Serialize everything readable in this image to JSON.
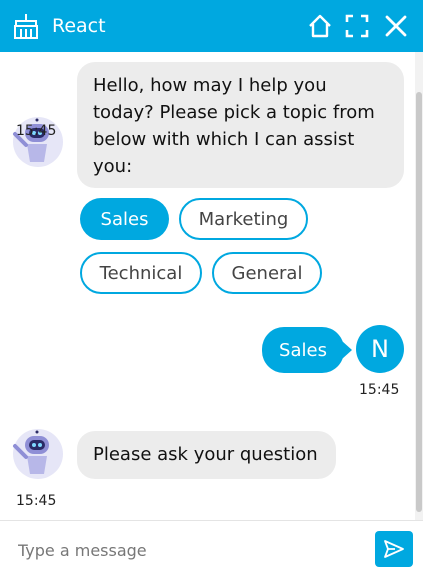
{
  "header": {
    "title": "React",
    "bg_color": "#00a8e0",
    "icons": [
      "broom-icon",
      "home-icon",
      "expand-icon",
      "close-icon"
    ]
  },
  "conversation": {
    "msg1": {
      "sender": "bot",
      "text": "Hello, how may I help you today? Please pick a topic from below with which I can assist you:",
      "time": "15:45",
      "options": [
        {
          "label": "Sales",
          "selected": true
        },
        {
          "label": "Marketing",
          "selected": false
        },
        {
          "label": "Technical",
          "selected": false
        },
        {
          "label": "General",
          "selected": false
        }
      ]
    },
    "msg2": {
      "sender": "user",
      "text": "Sales",
      "avatar_initial": "N",
      "time": "15:45"
    },
    "msg3": {
      "sender": "bot",
      "text": "Please ask your question",
      "time": "15:45"
    }
  },
  "composer": {
    "placeholder": "Type a message",
    "value": ""
  },
  "colors": {
    "accent": "#00a8e0",
    "bot_bubble": "#ececec"
  }
}
